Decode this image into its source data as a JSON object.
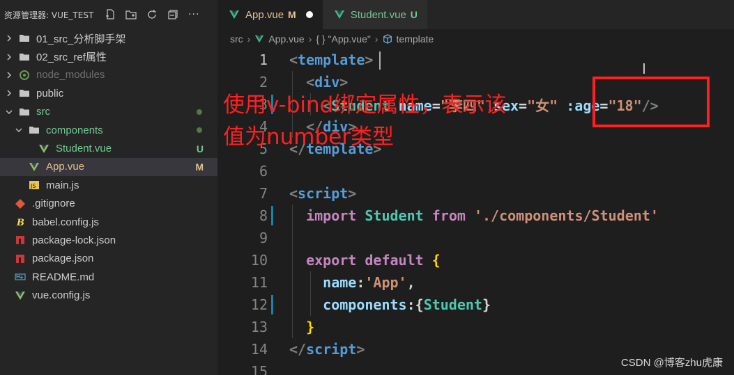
{
  "sidebar": {
    "title": "资源管理器: VUE_TEST",
    "actions": [
      "new-file-icon",
      "new-folder-icon",
      "refresh-icon",
      "collapse-icon",
      "more-icon"
    ],
    "more_label": "···",
    "items": [
      {
        "label": "01_src_分析脚手架",
        "type": "folder",
        "expanded": false,
        "indent": 0
      },
      {
        "label": "02_src_ref属性",
        "type": "folder",
        "expanded": false,
        "indent": 0
      },
      {
        "label": "node_modules",
        "type": "folder",
        "expanded": false,
        "indent": 0,
        "dimmed": true
      },
      {
        "label": "public",
        "type": "folder",
        "expanded": false,
        "indent": 0
      },
      {
        "label": "src",
        "type": "folder",
        "expanded": true,
        "indent": 0,
        "status": "dot"
      },
      {
        "label": "components",
        "type": "folder",
        "expanded": true,
        "indent": 1,
        "status": "dot"
      },
      {
        "label": "Student.vue",
        "type": "vue",
        "indent": 2,
        "status": "U"
      },
      {
        "label": "App.vue",
        "type": "vue",
        "indent": 1,
        "status": "M",
        "selected": true
      },
      {
        "label": "main.js",
        "type": "js",
        "indent": 1
      },
      {
        "label": ".gitignore",
        "type": "git",
        "indent": 0
      },
      {
        "label": "babel.config.js",
        "type": "babel",
        "indent": 0
      },
      {
        "label": "package-lock.json",
        "type": "npm",
        "indent": 0
      },
      {
        "label": "package.json",
        "type": "npm",
        "indent": 0
      },
      {
        "label": "README.md",
        "type": "md",
        "indent": 0
      },
      {
        "label": "vue.config.js",
        "type": "vue",
        "indent": 0
      }
    ]
  },
  "tabs": [
    {
      "label": "App.vue",
      "status": "M",
      "active": true,
      "modified": true
    },
    {
      "label": "Student.vue",
      "status": "U",
      "active": false
    }
  ],
  "breadcrumb": {
    "items": [
      "src",
      "App.vue",
      "{ } \"App.vue\"",
      "template"
    ]
  },
  "editor": {
    "line_numbers": [
      "1",
      "2",
      "3",
      "4",
      "5",
      "6",
      "7",
      "8",
      "9",
      "10",
      "11",
      "12",
      "13",
      "14",
      "15"
    ],
    "current_line": "1"
  },
  "annotation": {
    "text": "使用v-bind绑定属性，表示该值为number类型"
  },
  "watermark": "CSDN @博客zhu虎康",
  "colors": {
    "highlight_box": "#ff1f1f",
    "annotation": "#ff2020",
    "modified": "#e2c08d",
    "untracked": "#73c991"
  }
}
